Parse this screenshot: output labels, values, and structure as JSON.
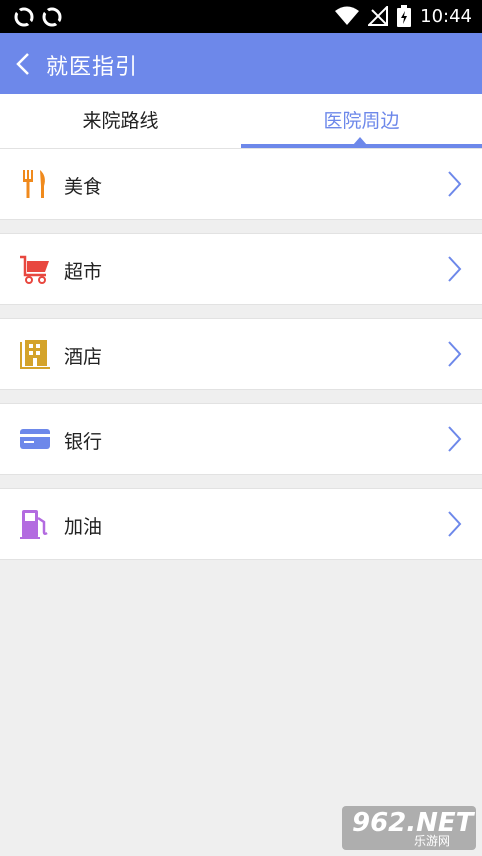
{
  "status_bar": {
    "time": "10:44",
    "icons": [
      "sync-icon",
      "sync-icon",
      "wifi-icon",
      "no-signal-icon",
      "battery-charging-icon"
    ]
  },
  "app_bar": {
    "title": "就医指引",
    "back_icon": "chevron-left-icon",
    "background": "#6d88ea"
  },
  "tabs": [
    {
      "label": "来院路线",
      "active": false
    },
    {
      "label": "医院周边",
      "active": true
    }
  ],
  "categories": [
    {
      "label": "美食",
      "icon": "restaurant-icon",
      "color": "#f08a1c"
    },
    {
      "label": "超市",
      "icon": "shopping-cart-icon",
      "color": "#e8473f"
    },
    {
      "label": "酒店",
      "icon": "hotel-icon",
      "color": "#d4a32a"
    },
    {
      "label": "银行",
      "icon": "bank-card-icon",
      "color": "#6d88ea"
    },
    {
      "label": "加油",
      "icon": "gas-station-icon",
      "color": "#b36be0"
    }
  ],
  "watermark": {
    "line1": "962.NET",
    "line2": "乐游网"
  }
}
